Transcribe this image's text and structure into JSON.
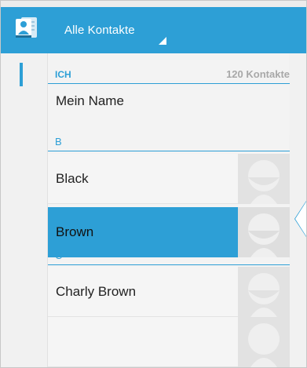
{
  "actionbar": {
    "title": "Alle Kontakte",
    "icon": "contacts-app-icon",
    "accent": "#2d9fd6"
  },
  "sections": [
    {
      "letter": "ICH",
      "count_label": "120 Kontakte"
    },
    {
      "letter": "B"
    },
    {
      "letter": "C"
    }
  ],
  "contacts": [
    {
      "name": "Mein Name",
      "selected": false
    },
    {
      "name": "Black",
      "selected": false
    },
    {
      "name": "Brown",
      "selected": true
    },
    {
      "name": "Charly Brown",
      "selected": false
    },
    {
      "name": "",
      "selected": false
    }
  ]
}
